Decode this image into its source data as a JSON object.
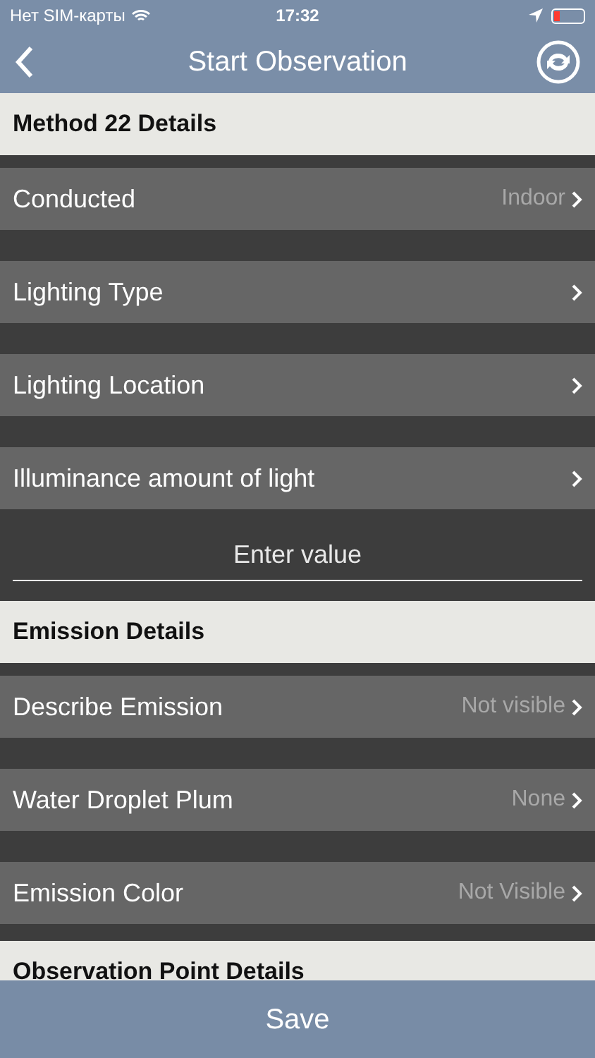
{
  "status_bar": {
    "carrier": "Нет SIM-карты",
    "time": "17:32",
    "battery_low": true
  },
  "nav": {
    "title": "Start Observation"
  },
  "sections": [
    {
      "title": "Method 22 Details",
      "items": [
        {
          "kind": "row",
          "label": "Conducted",
          "value": "Indoor"
        },
        {
          "kind": "row",
          "label": "Lighting Type"
        },
        {
          "kind": "row",
          "label": "Lighting Location"
        },
        {
          "kind": "row",
          "label": "Illuminance amount of light"
        },
        {
          "kind": "input",
          "placeholder": "Enter value"
        }
      ]
    },
    {
      "title": "Emission Details",
      "items": [
        {
          "kind": "row",
          "label": "Describe Emission",
          "value": "Not visible"
        },
        {
          "kind": "row",
          "label": "Water Droplet Plum",
          "value": "None"
        },
        {
          "kind": "row",
          "label": "Emission Color",
          "value": "Not Visible"
        }
      ]
    },
    {
      "title": "Observation Point Details"
    }
  ],
  "save_button": "Save"
}
